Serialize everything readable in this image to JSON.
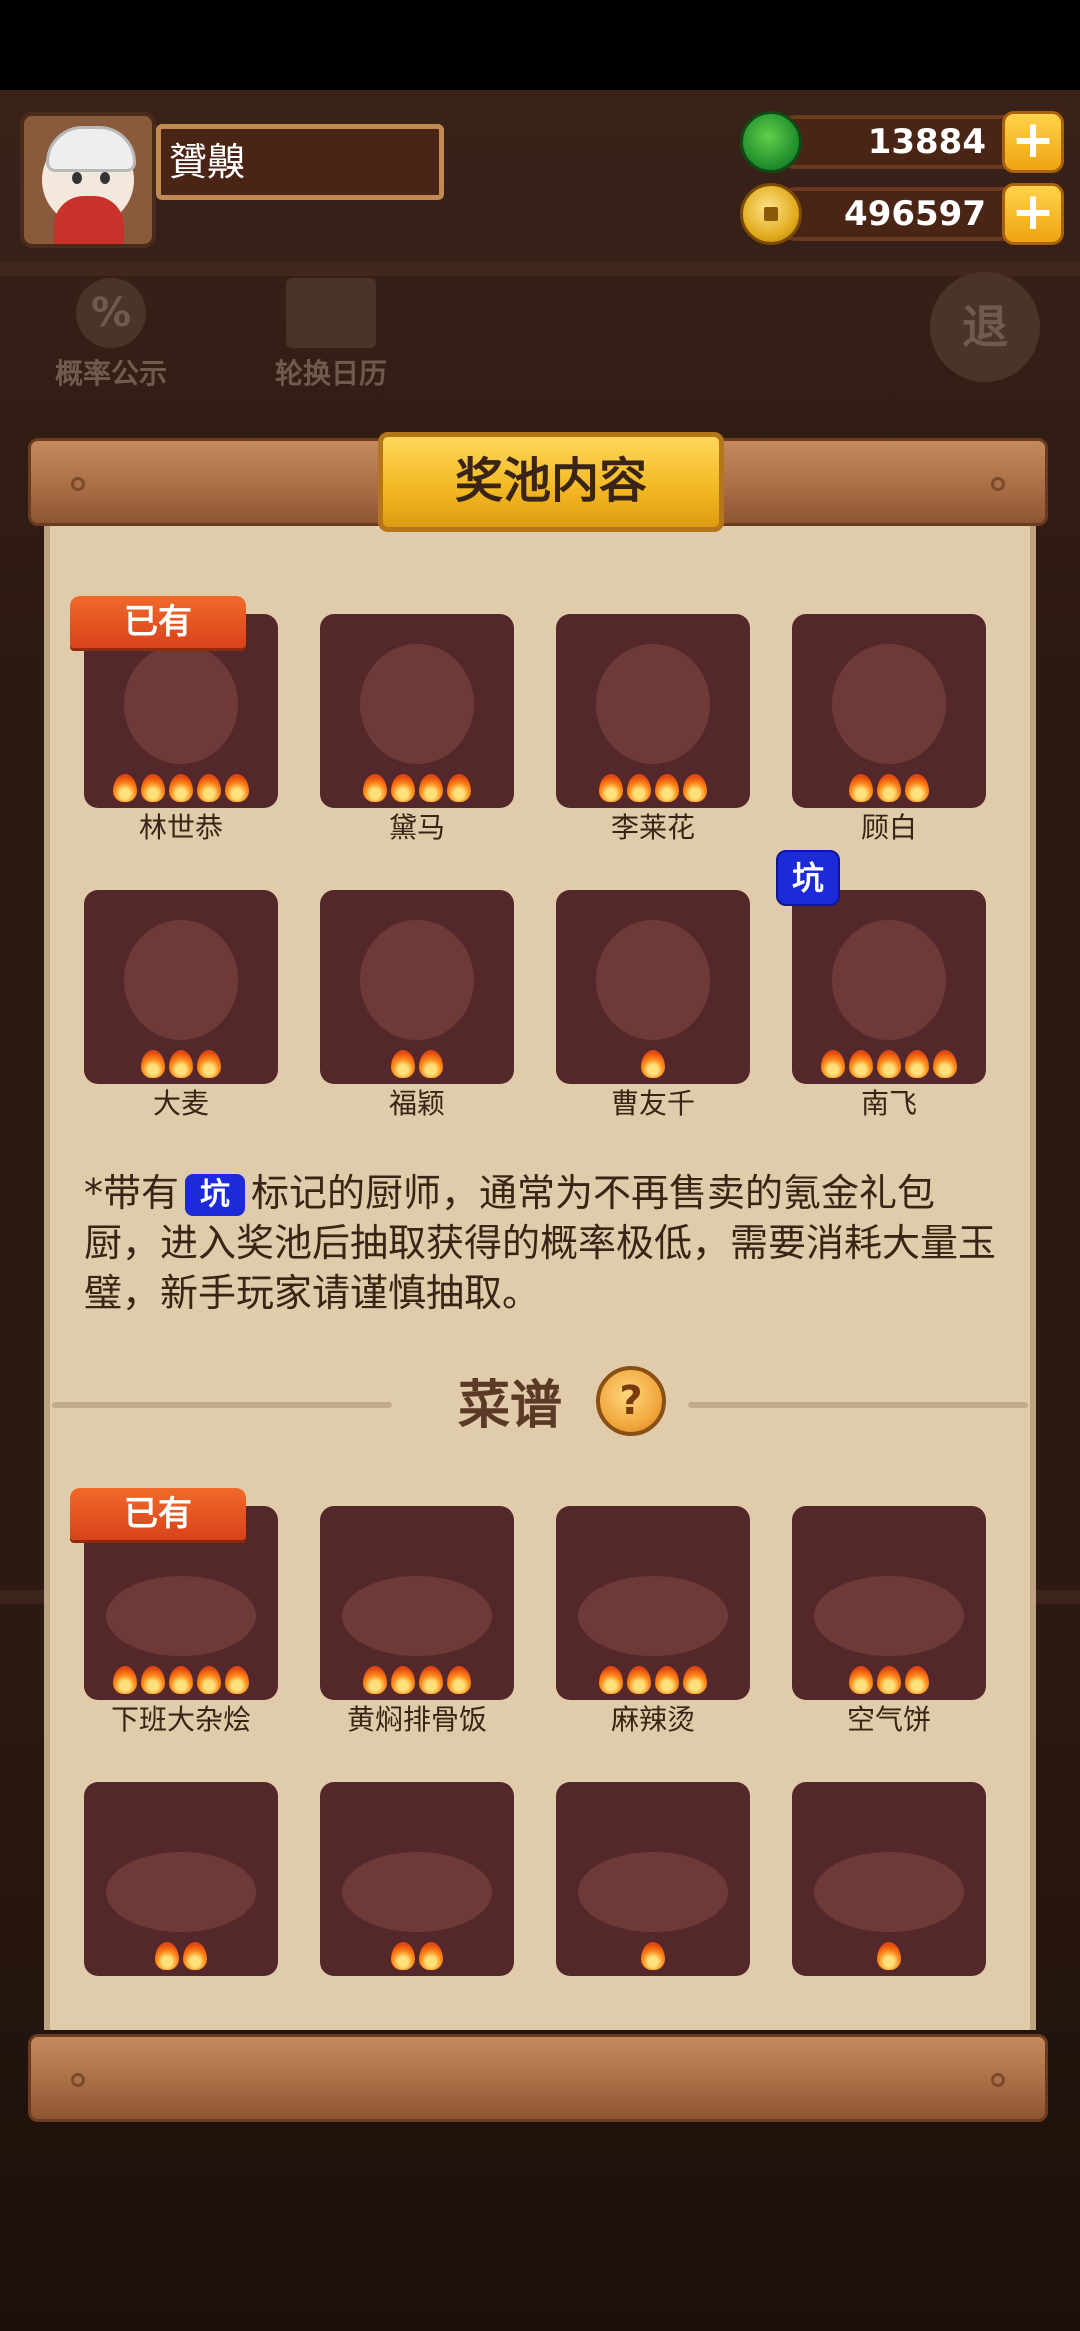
{
  "header": {
    "player_name": "贇齅",
    "jade_amount": "13884",
    "coin_amount": "496597",
    "icons": {
      "jade": "jade-currency-icon",
      "coin": "coin-currency-icon",
      "add": "plus-icon"
    }
  },
  "background": {
    "probability_label": "概率公示",
    "calendar_label": "轮换日历",
    "exit_label": "退"
  },
  "modal": {
    "title": "奖池内容",
    "owned_label": "已有",
    "pit_label": "坑",
    "chefs": [
      {
        "name": "林世恭",
        "stars": 5,
        "owned": true,
        "pit": false
      },
      {
        "name": "黛马",
        "stars": 4,
        "owned": false,
        "pit": false
      },
      {
        "name": "李莱花",
        "stars": 4,
        "owned": false,
        "pit": false
      },
      {
        "name": "顾白",
        "stars": 3,
        "owned": false,
        "pit": false
      },
      {
        "name": "大麦",
        "stars": 3,
        "owned": false,
        "pit": false
      },
      {
        "name": "福颖",
        "stars": 2,
        "owned": false,
        "pit": false
      },
      {
        "name": "曹友千",
        "stars": 1,
        "owned": false,
        "pit": false
      },
      {
        "name": "南飞",
        "stars": 5,
        "owned": false,
        "pit": true
      }
    ],
    "note_prefix": "*带有",
    "note_suffix": "标记的厨师，通常为不再售卖的氪金礼包厨，进入奖池后抽取获得的概率极低，需要消耗大量玉璧，新手玩家请谨慎抽取。",
    "recipes_title": "菜谱",
    "help_symbol": "?",
    "recipes": [
      {
        "name": "下班大杂烩",
        "stars": 5,
        "owned": true
      },
      {
        "name": "黄焖排骨饭",
        "stars": 4,
        "owned": false
      },
      {
        "name": "麻辣烫",
        "stars": 4,
        "owned": false
      },
      {
        "name": "空气饼",
        "stars": 3,
        "owned": false
      },
      {
        "name": "",
        "stars": 2,
        "owned": false
      },
      {
        "name": "",
        "stars": 2,
        "owned": false
      },
      {
        "name": "",
        "stars": 1,
        "owned": false
      },
      {
        "name": "",
        "stars": 1,
        "owned": false
      }
    ]
  },
  "colors": {
    "panel": "#e0ccab",
    "card": "#54282a",
    "owned_tag": "#e5501e",
    "pit_tag": "#1c2ad8",
    "title_plaque": "#f2b722"
  }
}
